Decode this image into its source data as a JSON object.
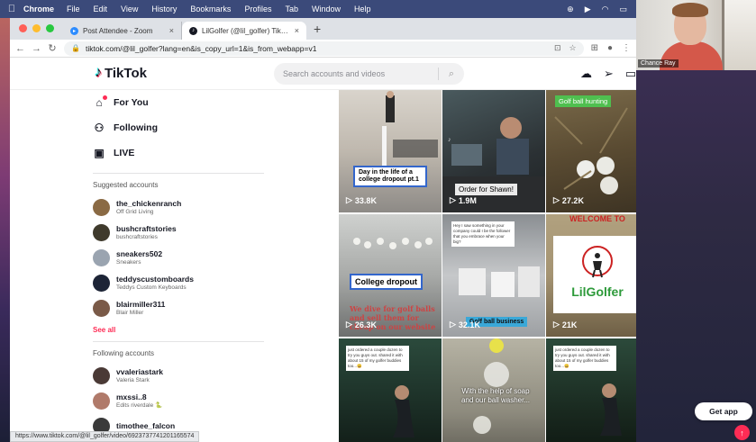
{
  "menubar": {
    "apple": "",
    "app": "Chrome",
    "items": [
      "File",
      "Edit",
      "View",
      "History",
      "Bookmarks",
      "Profiles",
      "Tab",
      "Window",
      "Help"
    ]
  },
  "browser": {
    "tabs": [
      {
        "title": "Post Attendee - Zoom",
        "favicon": "zoom-icon"
      },
      {
        "title": "LilGolfer (@lil_golfer) TikTok | ...",
        "favicon": "tiktok-icon"
      }
    ],
    "new_tab": "+",
    "url": "tiktok.com/@lil_golfer?lang=en&is_copy_url=1&is_from_webapp=v1"
  },
  "tiktok": {
    "logo": "TikTok",
    "search_placeholder": "Search accounts and videos",
    "nav": [
      {
        "label": "For You",
        "icon": "home-icon"
      },
      {
        "label": "Following",
        "icon": "people-icon"
      },
      {
        "label": "LIVE",
        "icon": "live-icon"
      }
    ],
    "suggested_header": "Suggested accounts",
    "suggested": [
      {
        "name": "the_chickenranch",
        "sub": "Off Grid Living",
        "color": "#8a6a44"
      },
      {
        "name": "bushcraftstories",
        "sub": "bushcraftstories",
        "color": "#3f3a2c"
      },
      {
        "name": "sneakers502",
        "sub": "Sneakers",
        "color": "#9aa4b0"
      },
      {
        "name": "teddyscustomboards",
        "sub": "Teddys Custom Keyboards",
        "color": "#1d2436"
      },
      {
        "name": "blairmiller311",
        "sub": "Blair Miller",
        "color": "#7a5a48"
      }
    ],
    "see_all": "See all",
    "following_header": "Following accounts",
    "following": [
      {
        "name": "vvaleriastark",
        "sub": "Valeria Stark",
        "color": "#4a3a36"
      },
      {
        "name": "mxssi..8",
        "sub": "Edits riverdale 🐍",
        "color": "#b07a6a"
      },
      {
        "name": "timothee_falcon",
        "sub": "",
        "color": "#3a3a3a"
      }
    ],
    "videos": [
      {
        "caption": "Day in the life of a college dropout pt.1",
        "views": "33.8K"
      },
      {
        "caption": "Order for Shawn!",
        "views": "1.9M"
      },
      {
        "caption": "Golf ball hunting",
        "views": "27.2K"
      },
      {
        "caption": "College dropout",
        "overlay": "We dive for golf balls and sell them for cheap on our website",
        "views": "26.3K"
      },
      {
        "caption": "Golf ball business",
        "overlay": "Hey I saw something in your company could I be the follower that you embrace when your big?",
        "views": "32.1K"
      },
      {
        "caption": "LilGolfer",
        "banner": "WELCOME TO",
        "views": "21K"
      },
      {
        "overlay": "just ordered a couple dozen to try you guys out. shared it with about 15 of my golfer buddies too...😀",
        "views": ""
      },
      {
        "overlay": "With the help of soap and our ball washer...",
        "views": ""
      },
      {
        "overlay": "just ordered a couple dozen to try you guys out. shared it with about 15 of my golfer buddies too...😀",
        "views": ""
      }
    ],
    "get_app": "Get app",
    "status_url": "https://www.tiktok.com/@lil_golfer/video/6923737741201165574"
  },
  "webcam": {
    "name": "Chance Ray"
  },
  "colors": {
    "accent": "#fe2c55",
    "menubar": "#3b4a7a"
  }
}
